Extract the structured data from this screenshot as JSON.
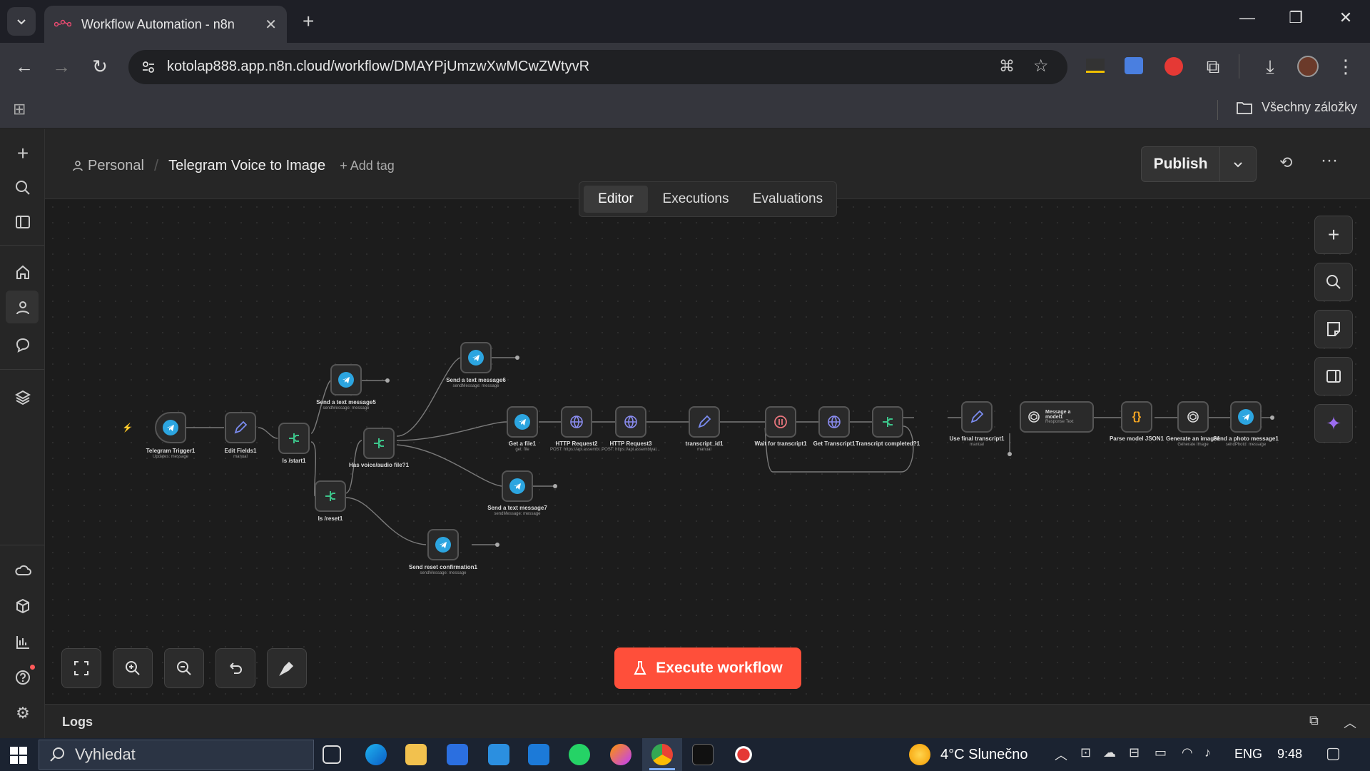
{
  "browser": {
    "tab_title": "Workflow Automation - n8n",
    "url": "kotolap888.app.n8n.cloud/workflow/DMAYPjUmzwXwMCwZWtyvR",
    "bookmarks_label": "Všechny záložky"
  },
  "header": {
    "project": "Personal",
    "workflow_name": "Telegram Voice to Image",
    "add_tag": "+ Add tag",
    "publish_label": "Publish",
    "tabs": [
      {
        "label": "Editor"
      },
      {
        "label": "Executions"
      },
      {
        "label": "Evaluations"
      }
    ]
  },
  "nodes": {
    "trigger": {
      "label": "Telegram Trigger1",
      "sub": "Updates: message"
    },
    "edit_fields": {
      "label": "Edit Fields1",
      "sub": "manual"
    },
    "is_start": {
      "label": "Is /start1"
    },
    "is_reset": {
      "label": "Is /reset1"
    },
    "send5": {
      "label": "Send a text message5",
      "sub": "sendMessage: message"
    },
    "send6": {
      "label": "Send a text message6",
      "sub": "sendMessage: message"
    },
    "has_voice": {
      "label": "Has voice/audio file?1"
    },
    "send7": {
      "label": "Send a text message7",
      "sub": "sendMessage: message"
    },
    "send_reset": {
      "label": "Send reset confirmation1",
      "sub": "sendMessage: message"
    },
    "get_file": {
      "label": "Get a file1",
      "sub": "get: file"
    },
    "http2": {
      "label": "HTTP Request2",
      "sub": "POST: https://api.assembl..."
    },
    "http3": {
      "label": "HTTP Request3",
      "sub": "POST: https://api.assemblyai..."
    },
    "transcript_id": {
      "label": "transcript_id1",
      "sub": "manual"
    },
    "wait": {
      "label": "Wait for transcript1"
    },
    "get_transcript": {
      "label": "Get Transcript1"
    },
    "transcript_completed": {
      "label": "Transcript completed?1"
    },
    "use_final": {
      "label": "Use final transcript1",
      "sub": "manual"
    },
    "message_model": {
      "label": "Message a model1",
      "sub": "Response Text"
    },
    "parse_json": {
      "label": "Parse model JSON1"
    },
    "generate_image": {
      "label": "Generate an image1",
      "sub": "Generate Image"
    },
    "send_photo": {
      "label": "Send a photo message1",
      "sub": "sendPhoto: message"
    }
  },
  "canvas": {
    "execute_label": "Execute workflow",
    "logs_label": "Logs"
  },
  "taskbar": {
    "search_placeholder": "Vyhledat",
    "weather": "4°C  Slunečno",
    "language": "ENG",
    "time": "9:48"
  }
}
